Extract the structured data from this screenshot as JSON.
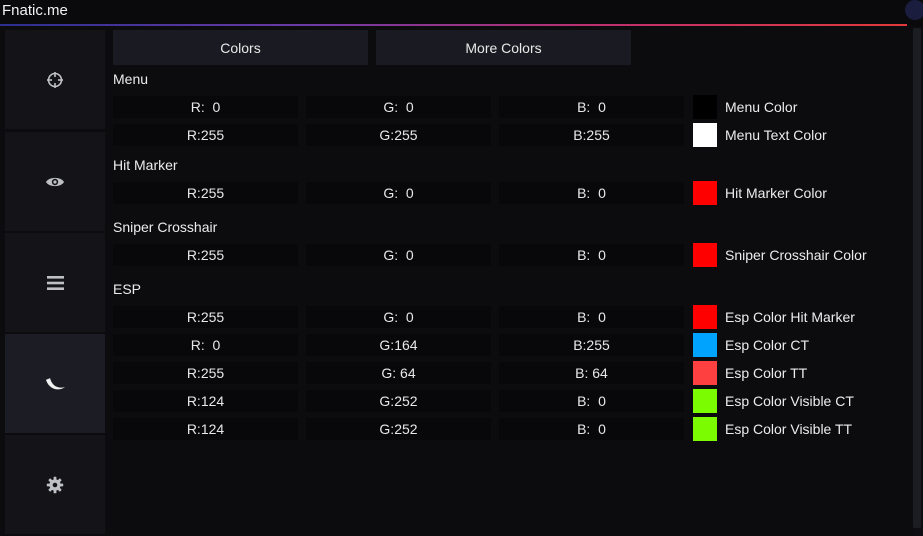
{
  "app": {
    "title": "Fnatic.me"
  },
  "sidebar": {
    "items": [
      {
        "icon": "crosshair-icon"
      },
      {
        "icon": "eye-icon"
      },
      {
        "icon": "hamburger-menu-icon"
      },
      {
        "icon": "moon-icon",
        "active": true
      },
      {
        "icon": "gear-icon"
      }
    ]
  },
  "tabs": [
    {
      "label": "Colors"
    },
    {
      "label": "More Colors"
    }
  ],
  "sections": {
    "menu": "Menu",
    "hit_marker": "Hit Marker",
    "sniper_crosshair": "Sniper Crosshair",
    "esp": "ESP"
  },
  "colors": [
    {
      "r": "R:  0",
      "g": "G:  0",
      "b": "B:  0",
      "label": "Menu Color",
      "swatch": "#000000"
    },
    {
      "r": "R:255",
      "g": "G:255",
      "b": "B:255",
      "label": "Menu Text Color",
      "swatch": "#ffffff"
    },
    {
      "r": "R:255",
      "g": "G:  0",
      "b": "B:  0",
      "label": "Hit Marker Color",
      "swatch": "#ff0000"
    },
    {
      "r": "R:255",
      "g": "G:  0",
      "b": "B:  0",
      "label": "Sniper Crosshair Color",
      "swatch": "#ff0000"
    },
    {
      "r": "R:255",
      "g": "G:  0",
      "b": "B:  0",
      "label": "Esp Color Hit Marker",
      "swatch": "#ff0000"
    },
    {
      "r": "R:  0",
      "g": "G:164",
      "b": "B:255",
      "label": "Esp Color CT",
      "swatch": "#00a4ff"
    },
    {
      "r": "R:255",
      "g": "G: 64",
      "b": "B: 64",
      "label": "Esp Color TT",
      "swatch": "#ff4040"
    },
    {
      "r": "R:124",
      "g": "G:252",
      "b": "B:  0",
      "label": "Esp Color Visible CT",
      "swatch": "#7cfc00"
    },
    {
      "r": "R:124",
      "g": "G:252",
      "b": "B:  0",
      "label": "Esp Color Visible TT",
      "swatch": "#7cfc00"
    }
  ]
}
